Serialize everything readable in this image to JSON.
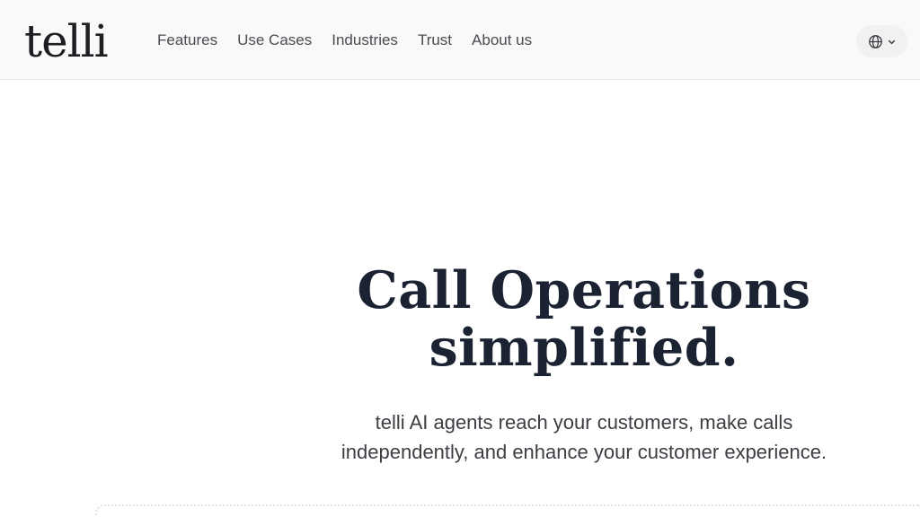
{
  "header": {
    "logo": "telli",
    "nav": [
      {
        "label": "Features"
      },
      {
        "label": "Use Cases"
      },
      {
        "label": "Industries"
      },
      {
        "label": "Trust"
      },
      {
        "label": "About us"
      }
    ],
    "language_icon": "globe-icon",
    "language_chevron": "chevron-down-icon"
  },
  "hero": {
    "title_line1": "Call Operations",
    "title_line2": "simplified.",
    "subtitle_line1": "telli AI agents reach your customers, make calls",
    "subtitle_line2": "independently, and enhance your customer experience."
  },
  "colors": {
    "header_bg": "#f9f9f9",
    "title": "#1b2333",
    "text": "#3d3d44"
  }
}
